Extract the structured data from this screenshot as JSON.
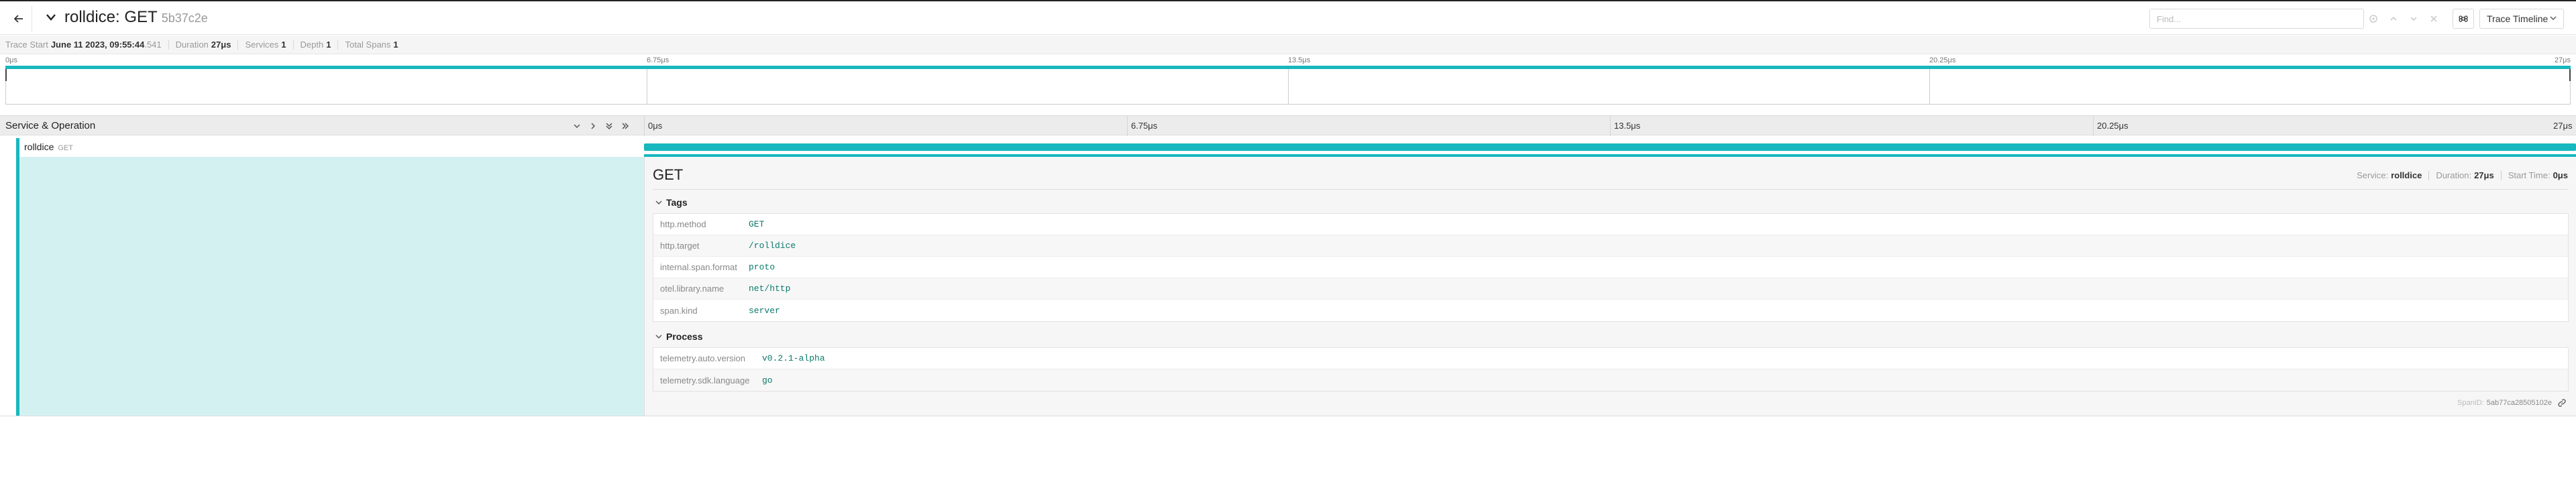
{
  "header": {
    "title": "rolldice: GET",
    "trace_id": "5b37c2e",
    "search_placeholder": "Find...",
    "view_mode": "Trace Timeline",
    "icons": [
      "back-arrow-icon",
      "chevron-down-icon",
      "target-icon",
      "arrow-up-icon",
      "arrow-down-icon",
      "close-icon",
      "keyboard-icon"
    ]
  },
  "summary": {
    "trace_start_label": "Trace Start",
    "trace_start_value": "June 11 2023, 09:55:44",
    "trace_start_ms": ".541",
    "duration_label": "Duration",
    "duration_value": "27μs",
    "services_label": "Services",
    "services_value": "1",
    "depth_label": "Depth",
    "depth_value": "1",
    "total_spans_label": "Total Spans",
    "total_spans_value": "1"
  },
  "minimap": {
    "ticks": [
      "0μs",
      "6.75μs",
      "13.5μs",
      "20.25μs",
      "27μs"
    ]
  },
  "timeline": {
    "header_title": "Service & Operation",
    "ticks": [
      "0μs",
      "6.75μs",
      "13.5μs",
      "20.25μs",
      "27μs"
    ],
    "controls": [
      "collapse-one-icon",
      "expand-one-icon",
      "collapse-all-icon",
      "expand-all-icon"
    ]
  },
  "span": {
    "service": "rolldice",
    "operation": "GET",
    "bar_start_fraction": 0.0,
    "bar_end_fraction": 1.0,
    "color": "#17b8be"
  },
  "detail": {
    "title": "GET",
    "service_label": "Service:",
    "service_value": "rolldice",
    "duration_label": "Duration:",
    "duration_value": "27μs",
    "start_label": "Start Time:",
    "start_value": "0μs",
    "tags_title": "Tags",
    "tags": [
      {
        "key": "http.method",
        "value": "GET"
      },
      {
        "key": "http.target",
        "value": "/rolldice"
      },
      {
        "key": "internal.span.format",
        "value": "proto"
      },
      {
        "key": "otel.library.name",
        "value": "net/http"
      },
      {
        "key": "span.kind",
        "value": "server"
      }
    ],
    "process_title": "Process",
    "process": [
      {
        "key": "telemetry.auto.version",
        "value": "v0.2.1-alpha"
      },
      {
        "key": "telemetry.sdk.language",
        "value": "go"
      }
    ],
    "span_id_label": "SpanID:",
    "span_id_value": "5ab77ca28505102e"
  }
}
